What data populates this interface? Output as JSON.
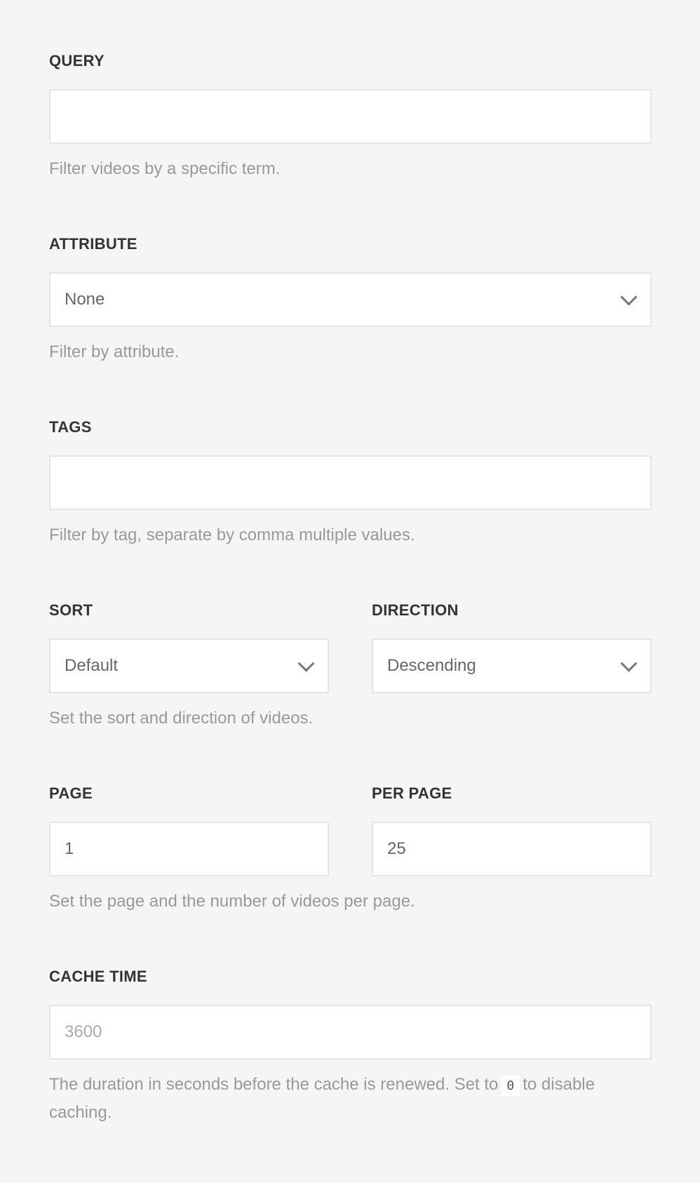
{
  "query": {
    "label": "QUERY",
    "value": "",
    "help": "Filter videos by a specific term."
  },
  "attribute": {
    "label": "ATTRIBUTE",
    "value": "None",
    "help": "Filter by attribute."
  },
  "tags": {
    "label": "TAGS",
    "value": "",
    "help": "Filter by tag, separate by comma multiple values."
  },
  "sort": {
    "label": "SORT",
    "value": "Default"
  },
  "direction": {
    "label": "DIRECTION",
    "value": "Descending"
  },
  "sort_help": "Set the sort and direction of videos.",
  "page": {
    "label": "PAGE",
    "value": "1"
  },
  "per_page": {
    "label": "PER PAGE",
    "value": "25"
  },
  "page_help": "Set the page and the number of videos per page.",
  "cache": {
    "label": "CACHE TIME",
    "placeholder": "3600",
    "help_before": "The duration in seconds before the cache is renewed. Set to",
    "help_code": "0",
    "help_after": "to disable caching."
  }
}
